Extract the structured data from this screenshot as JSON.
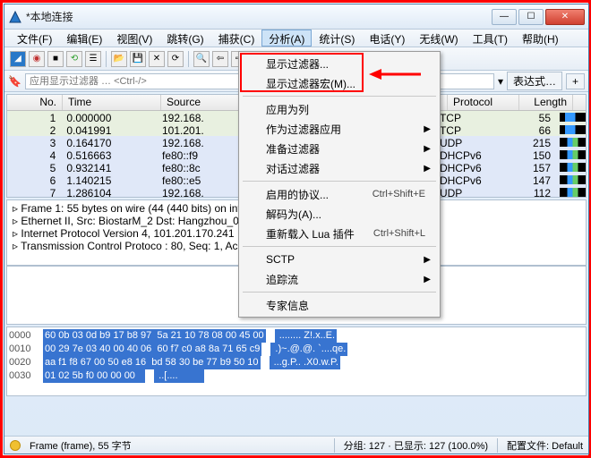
{
  "window": {
    "title": "*本地连接",
    "min": "—",
    "max": "☐",
    "close": "✕"
  },
  "menu": {
    "items": [
      "文件(F)",
      "编辑(E)",
      "视图(V)",
      "跳转(G)",
      "捕获(C)",
      "分析(A)",
      "统计(S)",
      "电话(Y)",
      "无线(W)",
      "工具(T)",
      "帮助(H)"
    ],
    "active_index": 5
  },
  "dropdown": {
    "items": [
      {
        "label": "显示过滤器..."
      },
      {
        "label": "显示过滤器宏(M)..."
      },
      {
        "sep": true
      },
      {
        "label": "应用为列"
      },
      {
        "label": "作为过滤器应用",
        "sub": true
      },
      {
        "label": "准备过滤器",
        "sub": true
      },
      {
        "label": "对话过滤器",
        "sub": true
      },
      {
        "sep": true
      },
      {
        "label": "启用的协议...",
        "shortcut": "Ctrl+Shift+E"
      },
      {
        "label": "解码为(A)..."
      },
      {
        "label": "重新载入 Lua 插件",
        "shortcut": "Ctrl+Shift+L"
      },
      {
        "sep": true
      },
      {
        "label": "SCTP",
        "sub": true
      },
      {
        "label": "追踪流",
        "sub": true
      },
      {
        "sep": true
      },
      {
        "label": "专家信息"
      }
    ]
  },
  "filter": {
    "placeholder": "应用显示过滤器 … <Ctrl-/>",
    "expr_label": "表达式…",
    "plus": "+"
  },
  "packets": {
    "headers": {
      "no": "No.",
      "time": "Time",
      "src": "Source",
      "proto": "Protocol",
      "len": "Length"
    },
    "rows": [
      {
        "no": "1",
        "time": "0.000000",
        "src": "192.168.",
        "proto": "TCP",
        "len": "55"
      },
      {
        "no": "2",
        "time": "0.041991",
        "src": "101.201.",
        "proto": "TCP",
        "len": "66"
      },
      {
        "no": "3",
        "time": "0.164170",
        "src": "192.168.",
        "proto": "UDP",
        "len": "215"
      },
      {
        "no": "4",
        "time": "0.516663",
        "src": "fe80::f9",
        "proto": "DHCPv6",
        "len": "150"
      },
      {
        "no": "5",
        "time": "0.932141",
        "src": "fe80::8c",
        "proto": "DHCPv6",
        "len": "157"
      },
      {
        "no": "6",
        "time": "1.140215",
        "src": "fe80::e5",
        "proto": "DHCPv6",
        "len": "147"
      },
      {
        "no": "7",
        "time": "1.286104",
        "src": "192.168.",
        "proto": "UDP",
        "len": "112"
      }
    ]
  },
  "details": {
    "lines": [
      "▹ Frame 1: 55 bytes on wire (44                          (440 bits) on interface 0",
      "▹ Ethernet II, Src: BiostarM_2                            Dst: Hangzhou_0d:b9:17 (",
      "▹ Internet Protocol Version 4,                           101.201.170.241",
      "▹ Transmission Control Protoco                           : 80, Seq: 1, Ack: 1, Len"
    ]
  },
  "hex": {
    "rows": [
      {
        "off": "0000",
        "bytes": "60 0b 03 0d b9 17 b8 97  5a 21 10 78 08 00 45 00",
        "asc": " ........ Z!.x..E."
      },
      {
        "off": "0010",
        "bytes": "00 29 7e 03 40 00 40 06  60 f7 c0 a8 8a 71 65 c9",
        "asc": " .)~.@.@. `....qe."
      },
      {
        "off": "0020",
        "bytes": "aa f1 f8 67 00 50 e8 16  bd 58 30 be 77 b9 50 10",
        "asc": " ...g.P.. .X0.w.P."
      },
      {
        "off": "0030",
        "bytes": "01 02 5b f0 00 00 00   ",
        "asc": " ..[....         "
      }
    ]
  },
  "status": {
    "frame": "Frame (frame), 55 字节",
    "pkts": "分组: 127 · 已显示: 127 (100.0%)",
    "profile": "配置文件: Default"
  }
}
